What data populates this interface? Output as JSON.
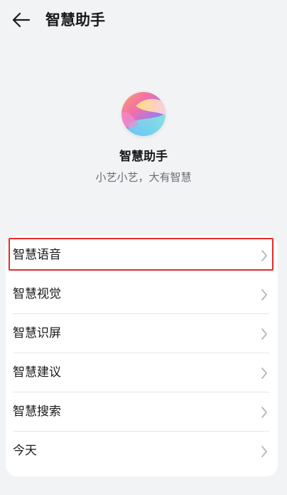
{
  "header": {
    "back_icon": "back-arrow-icon",
    "title": "智慧助手"
  },
  "hero": {
    "logo_icon": "assistant-logo-icon",
    "name": "智慧助手",
    "slogan": "小艺小艺，大有智慧"
  },
  "menu": {
    "items": [
      {
        "label": "智慧语音",
        "icon": "chevron-right-icon",
        "highlighted": true
      },
      {
        "label": "智慧视觉",
        "icon": "chevron-right-icon"
      },
      {
        "label": "智慧识屏",
        "icon": "chevron-right-icon"
      },
      {
        "label": "智慧建议",
        "icon": "chevron-right-icon"
      },
      {
        "label": "智慧搜索",
        "icon": "chevron-right-icon"
      },
      {
        "label": "今天",
        "icon": "chevron-right-icon"
      }
    ]
  },
  "colors": {
    "background": "#f1f3f5",
    "card": "#ffffff",
    "highlight_border": "#e52b2b",
    "secondary_text": "#6a6d72"
  }
}
